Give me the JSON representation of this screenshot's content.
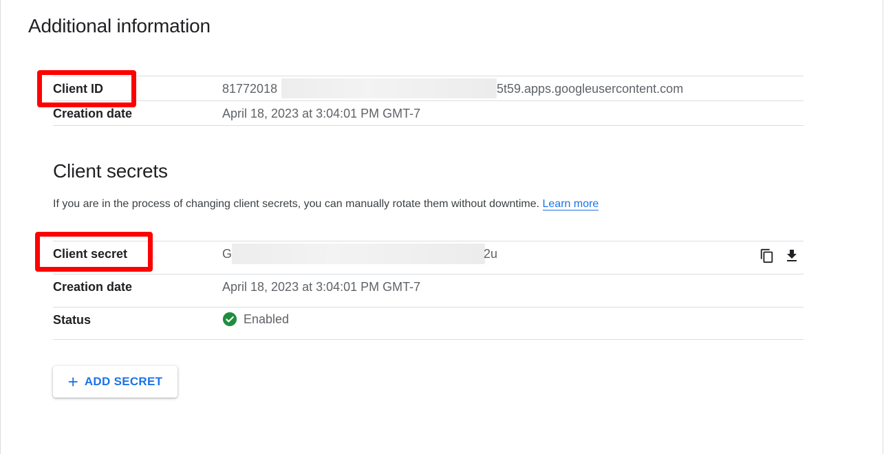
{
  "page": {
    "title": "Additional information"
  },
  "client": {
    "id_label": "Client ID",
    "id_value_prefix": "81772018",
    "id_value_suffix": "5t59.apps.googleusercontent.com",
    "creation_label": "Creation date",
    "creation_value": "April 18, 2023 at 3:04:01 PM GMT-7"
  },
  "secrets": {
    "title": "Client secrets",
    "description": "If you are in the process of changing client secrets, you can manually rotate them without downtime.",
    "learn_more": "Learn more",
    "secret_label": "Client secret",
    "secret_prefix": "G",
    "secret_suffix": "2u",
    "creation_label": "Creation date",
    "creation_value": "April 18, 2023 at 3:04:01 PM GMT-7",
    "status_label": "Status",
    "status_value": "Enabled",
    "copy_icon": "copy-icon",
    "download_icon": "download-icon",
    "status_icon": "check-circle-icon"
  },
  "actions": {
    "add_secret_label": "ADD SECRET",
    "add_icon": "plus-icon"
  },
  "colors": {
    "accent": "#1a73e8",
    "highlight": "#ff0000",
    "success": "#1e8e3e"
  }
}
